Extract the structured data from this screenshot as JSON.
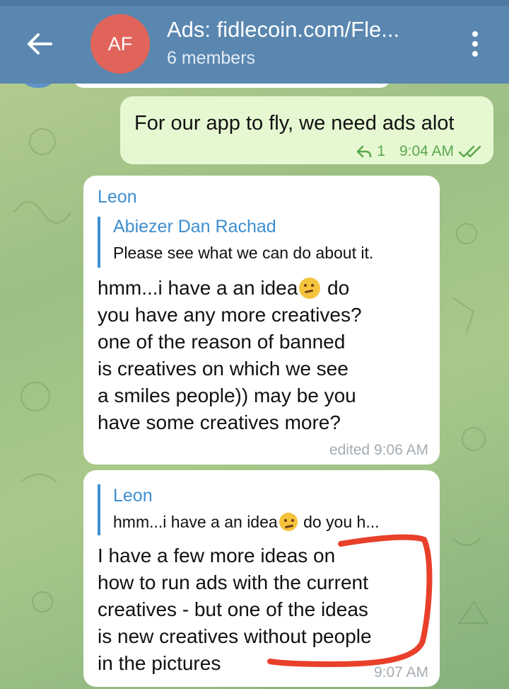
{
  "header": {
    "avatar_initials": "AF",
    "title": "Ads: fidlecoin.com/Fle...",
    "subtitle": "6 members",
    "colors": {
      "bar": "#5a87b0",
      "avatar": "#e0645a"
    }
  },
  "messages": [
    {
      "direction": "outgoing",
      "text": "For our app to fly, we need ads alot",
      "reply_count": "1",
      "time": "9:04 AM",
      "status_icon": "double-check-icon"
    },
    {
      "direction": "incoming",
      "sender": "Leon",
      "quote": {
        "name": "Abiezer Dan Rachad",
        "text": "Please see what we can do about it."
      },
      "lines": [
        "hmm...i have a an idea",
        " do",
        "you have any more creatives?",
        "one of the reason of banned",
        "is creatives on which we see",
        "a smiles people)) may be you",
        "have some creatives more?"
      ],
      "emoji": "thinking-face-icon",
      "time": "edited 9:06 AM"
    },
    {
      "direction": "incoming",
      "quote": {
        "name": "Leon",
        "text_before": "hmm...i have a an idea",
        "text_after": " do you h..."
      },
      "lines": [
        "I have a few more ideas on",
        "how to run ads with the current",
        "creatives - but one of the ideas",
        "is new creatives without people",
        "in the pictures"
      ],
      "time": "9:07 AM"
    }
  ],
  "annotation": {
    "color": "#e8402a"
  }
}
